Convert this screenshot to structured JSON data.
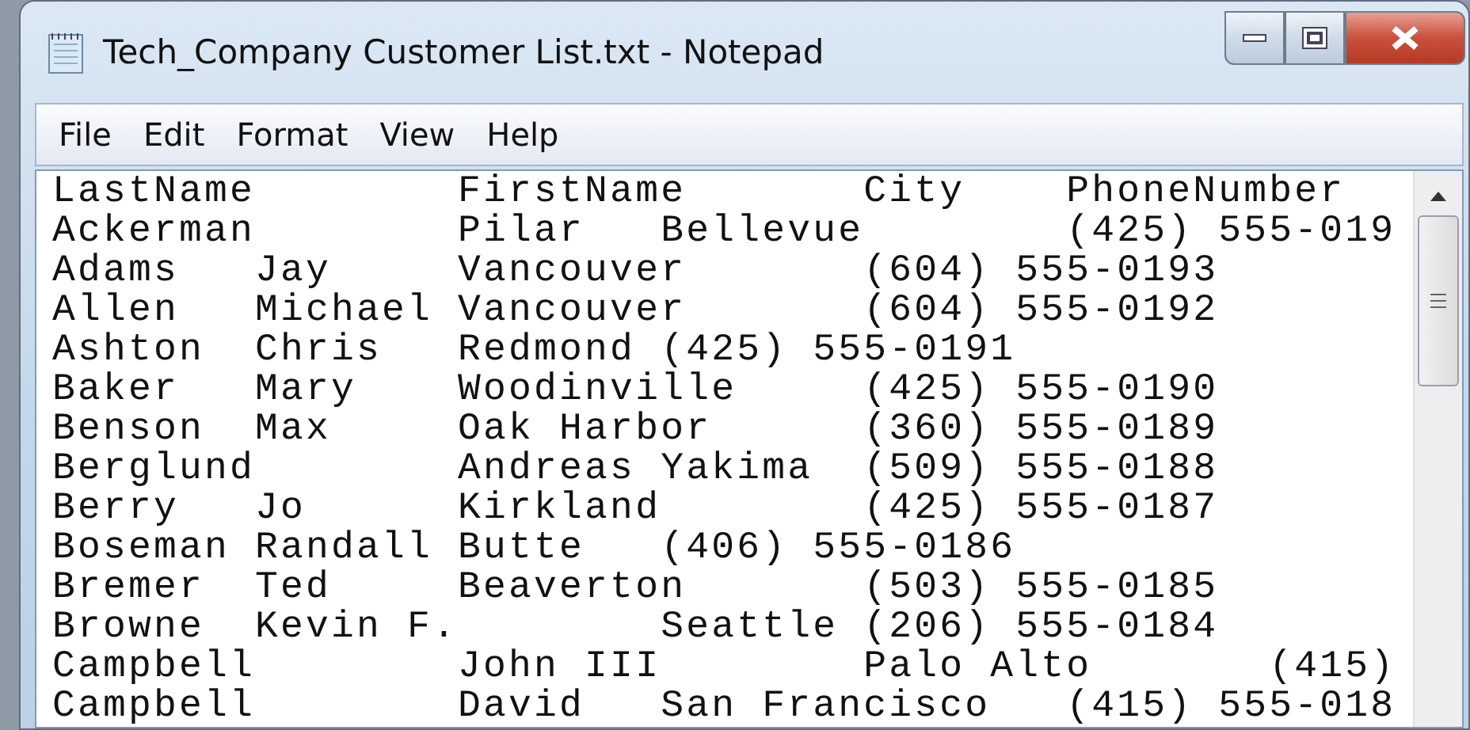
{
  "window": {
    "title": "Tech_Company Customer List.txt - Notepad"
  },
  "menu": [
    "File",
    "Edit",
    "Format",
    "View",
    "Help"
  ],
  "editor": {
    "lines": [
      "LastName\tFirstName\tCity\tPhoneNumber",
      "Ackerman\tPilar\tBellevue\t(425) 555-019",
      "Adams\tJay\tVancouver\t(604) 555-0193",
      "Allen\tMichael\tVancouver\t(604) 555-0192",
      "Ashton\tChris\tRedmond\t(425) 555-0191",
      "Baker\tMary\tWoodinville\t(425) 555-0190",
      "Benson\tMax\tOak Harbor\t(360) 555-0189",
      "Berglund\tAndreas\tYakima\t(509) 555-0188",
      "Berry\tJo\tKirkland\t(425) 555-0187",
      "Boseman\tRandall\tButte\t(406) 555-0186",
      "Bremer\tTed\tBeaverton\t(503) 555-0185",
      "Browne\tKevin F.\tSeattle\t(206) 555-0184",
      "Campbell\tJohn III\tPalo Alto\t(415)",
      "Campbell\tDavid\tSan Francisco\t(415) 555-018"
    ]
  }
}
